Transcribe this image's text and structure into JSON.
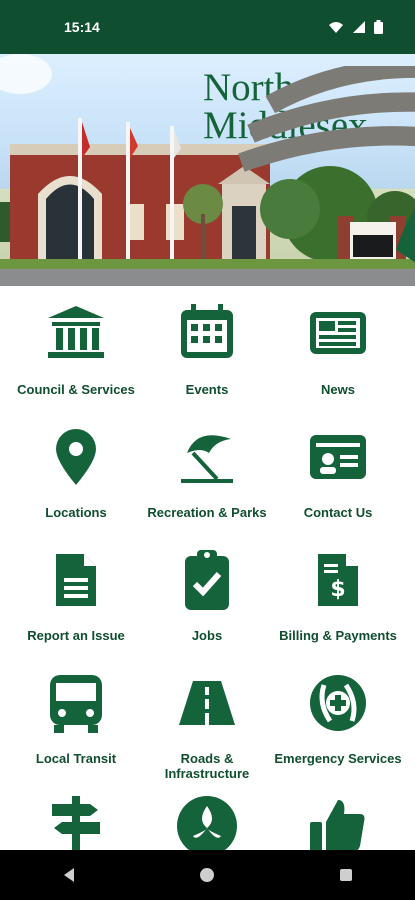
{
  "status_bar": {
    "time": "15:14"
  },
  "logo": {
    "line1": "North",
    "line2": "Middlesex"
  },
  "tiles": [
    {
      "label": "Council & Services",
      "icon": "government-building-icon"
    },
    {
      "label": "Events",
      "icon": "calendar-icon"
    },
    {
      "label": "News",
      "icon": "newspaper-icon"
    },
    {
      "label": "Locations",
      "icon": "map-pin-icon"
    },
    {
      "label": "Recreation & Parks",
      "icon": "beach-umbrella-icon"
    },
    {
      "label": "Contact Us",
      "icon": "contact-card-icon"
    },
    {
      "label": "Report an Issue",
      "icon": "document-icon"
    },
    {
      "label": "Jobs",
      "icon": "clipboard-check-icon"
    },
    {
      "label": "Billing & Payments",
      "icon": "invoice-dollar-icon"
    },
    {
      "label": "Local Transit",
      "icon": "bus-icon"
    },
    {
      "label": "Roads & Infrastructure",
      "icon": "road-icon"
    },
    {
      "label": "Emergency Services",
      "icon": "emergency-services-icon"
    },
    {
      "label": "",
      "icon": "signpost-icon"
    },
    {
      "label": "",
      "icon": "ontario-trillium-icon"
    },
    {
      "label": "",
      "icon": "thumbs-up-icon"
    }
  ],
  "colors": {
    "accent": "#15633b",
    "statusbar": "#0f4f2f"
  }
}
